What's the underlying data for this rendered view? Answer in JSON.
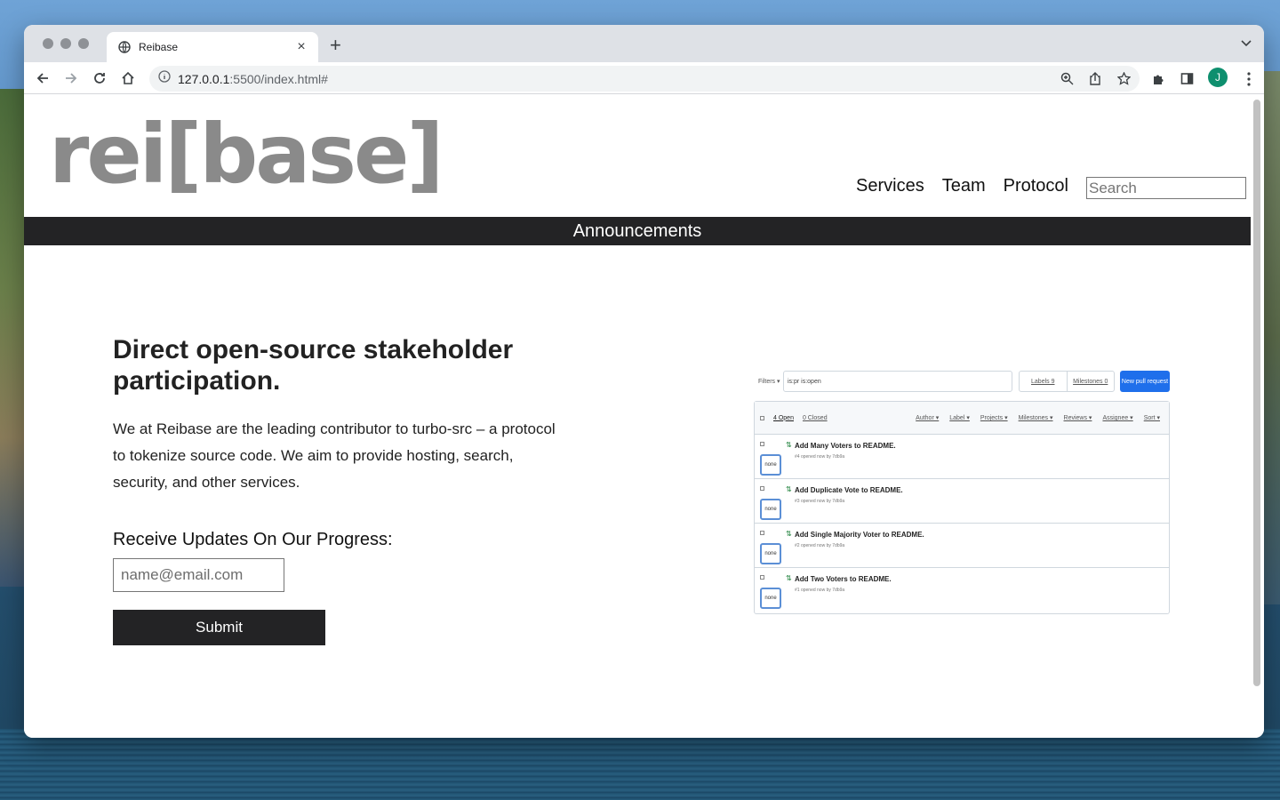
{
  "browser": {
    "tab_title": "Reibase",
    "url_host": "127.0.0.1",
    "url_rest": ":5500/index.html#",
    "avatar_letter": "J"
  },
  "site": {
    "logo_text": "rei[base]",
    "nav": [
      "Services",
      "Team",
      "Protocol"
    ],
    "search_placeholder": "Search",
    "announcement": "Announcements"
  },
  "hero": {
    "title": "Direct open-source stakeholder participation.",
    "text": "We at Reibase are the leading contributor to turbo-src – a protocol to tokenize source code. We aim to provide hosting, search, security, and other services.",
    "updates_label": "Receive Updates On Our Progress:",
    "email_placeholder": "name@email.com",
    "submit_label": "Submit"
  },
  "pr_screenshot": {
    "filters_label": "Filters ▾",
    "search_value": "is:pr is:open",
    "labels_btn": "Labels 9",
    "milestones_btn": "Milestones 0",
    "new_pr_label": "New pull request",
    "open_count": "4 Open",
    "closed_count": "0 Closed",
    "head_filters": [
      "Author ▾",
      "Label ▾",
      "Projects ▾",
      "Milestones ▾",
      "Reviews ▾",
      "Assignee ▾",
      "Sort ▾"
    ],
    "rows": [
      {
        "title": "Add Many Voters to README.",
        "meta": "#4 opened now by 7db9a",
        "vote": "none"
      },
      {
        "title": "Add Duplicate Vote to README.",
        "meta": "#3 opened now by 7db9a",
        "vote": "none"
      },
      {
        "title": "Add Single Majority Voter to README.",
        "meta": "#2 opened now by 7db9a",
        "vote": "none"
      },
      {
        "title": "Add Two Voters to README.",
        "meta": "#1 opened now by 7db9a",
        "vote": "none"
      }
    ]
  }
}
